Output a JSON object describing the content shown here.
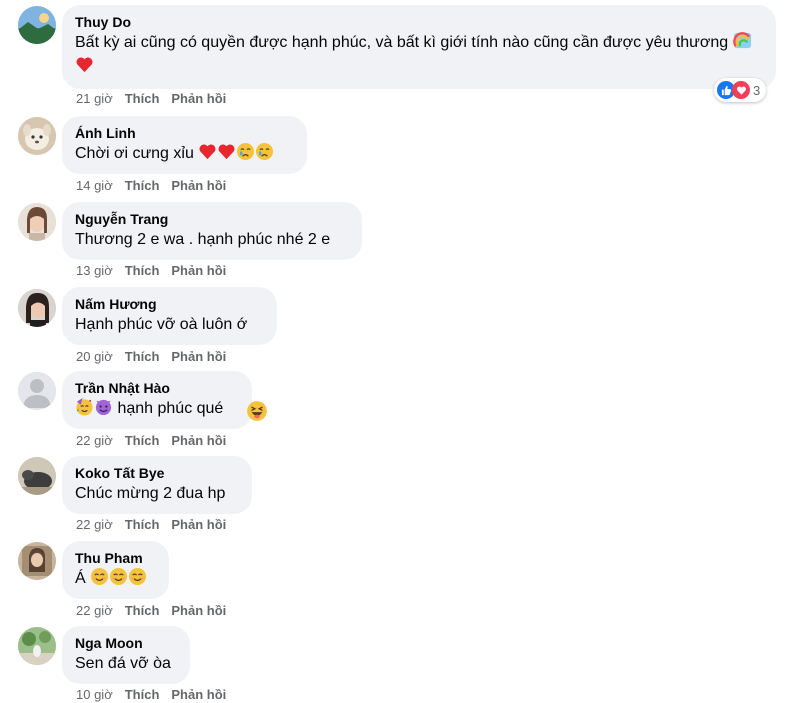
{
  "actions": {
    "like": "Thích",
    "reply": "Phản hồi"
  },
  "comments": [
    {
      "author": "Thuy Do",
      "text": "Bất kỳ ai cũng có quyền được hạnh phúc, và bất kì giới tính nào cũng cần được yêu thương",
      "time": "21 giờ",
      "reaction_count": "3",
      "avatar": "landscape-avatar"
    },
    {
      "author": "Ánh Linh",
      "text": "Chời ơi cưng xỉu",
      "time": "14 giờ",
      "avatar": "dog-avatar"
    },
    {
      "author": "Nguyễn Trang",
      "text": "Thương 2 e wa . hạnh phúc nhé 2 e",
      "time": "13 giờ",
      "avatar": "woman-avatar"
    },
    {
      "author": "Nấm Hương",
      "text": "Hạnh phúc vỡ oà luôn ớ",
      "time": "20 giờ",
      "avatar": "woman-dark-avatar"
    },
    {
      "author": "Trần Nhật Hào",
      "text": "hạnh phúc qué",
      "time": "22 giờ",
      "avatar": "default-avatar"
    },
    {
      "author": "Koko Tất Bye",
      "text": "Chúc mừng 2 đua hp",
      "time": "22 giờ",
      "avatar": "animal-avatar"
    },
    {
      "author": "Thu Pham",
      "text": "Á",
      "time": "22 giờ",
      "avatar": "portrait-avatar"
    },
    {
      "author": "Nga Moon",
      "text": "Sen đá vỡ òa",
      "time": "10 giờ",
      "avatar": "nature-avatar"
    }
  ],
  "colors": {
    "bubble": "#f0f2f5",
    "meta": "#65676b",
    "like_blue": "#1877f2",
    "love_red": "#f33e58"
  }
}
